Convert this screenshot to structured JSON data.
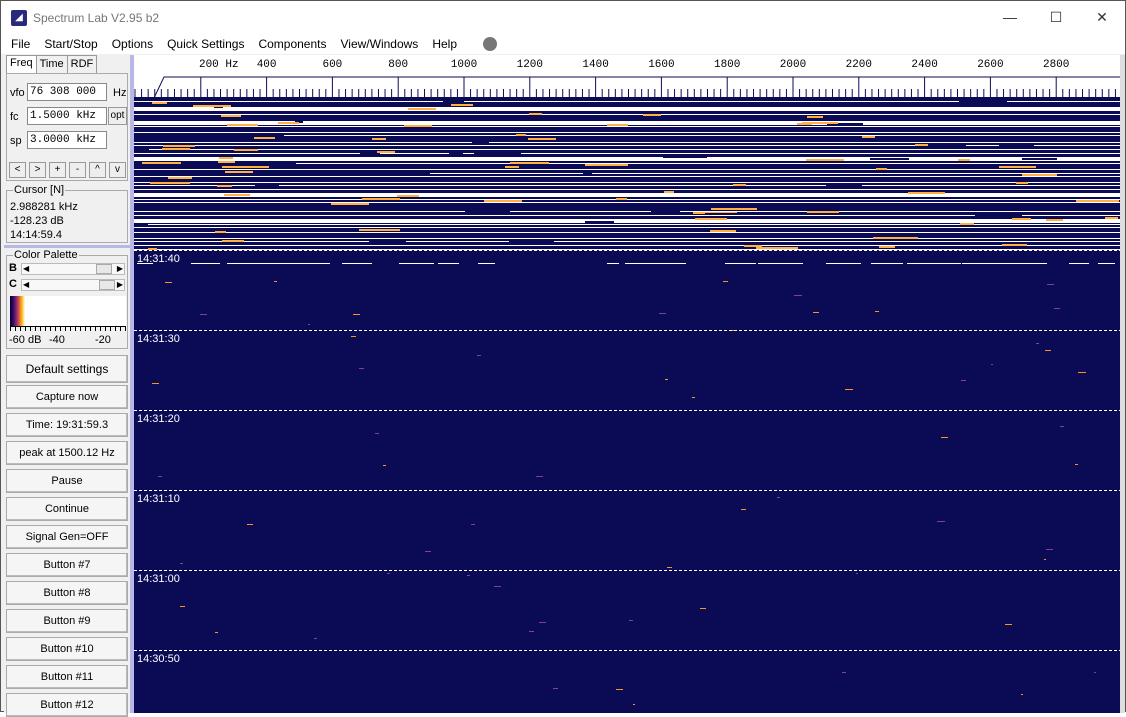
{
  "window": {
    "title": "Spectrum Lab V2.95 b2",
    "icon": "satellite-dish-icon"
  },
  "menu": [
    "File",
    "Start/Stop",
    "Options",
    "Quick Settings",
    "Components",
    "View/Windows",
    "Help"
  ],
  "tabs": [
    "Freq",
    "Time",
    "RDF"
  ],
  "freq": {
    "vfo_label": "vfo",
    "vfo": "76 308 000",
    "vfo_unit": "Hz",
    "fc_label": "fc",
    "fc": "1.5000 kHz",
    "opt": "opt",
    "sp_label": "sp",
    "sp": "3.0000 kHz",
    "step_buttons": [
      "<",
      ">",
      "+",
      "-",
      "^",
      "v"
    ]
  },
  "cursor": {
    "label": "Cursor [N]",
    "freq": "2.988281 kHz",
    "level": "-128.23 dB",
    "time": "14:14:59.4"
  },
  "palette": {
    "label": "Color Palette",
    "b": "B",
    "c": "C",
    "scale": [
      "-60 dB",
      "-40",
      "-20"
    ],
    "b_pos": 0.85,
    "c_pos": 0.9
  },
  "buttons": [
    "Default settings",
    "Capture now",
    "Time:  19:31:59.3",
    "peak at 1500.12 Hz",
    "Pause",
    "Continue",
    "Signal Gen=OFF",
    "Button #7",
    "Button #8",
    "Button #9",
    "Button #10",
    "Button #11",
    "Button #12"
  ],
  "axis": {
    "labels": [
      "200 Hz",
      "400",
      "600",
      "800",
      "1000",
      "1200",
      "1400",
      "1600",
      "1800",
      "2000",
      "2200",
      "2400",
      "2600",
      "2800"
    ]
  },
  "waterfall": {
    "background": "#0b0b55",
    "time_labels": [
      "14:31:40",
      "14:31:30",
      "14:31:20",
      "14:31:10",
      "14:31:00",
      "14:30:50"
    ]
  }
}
